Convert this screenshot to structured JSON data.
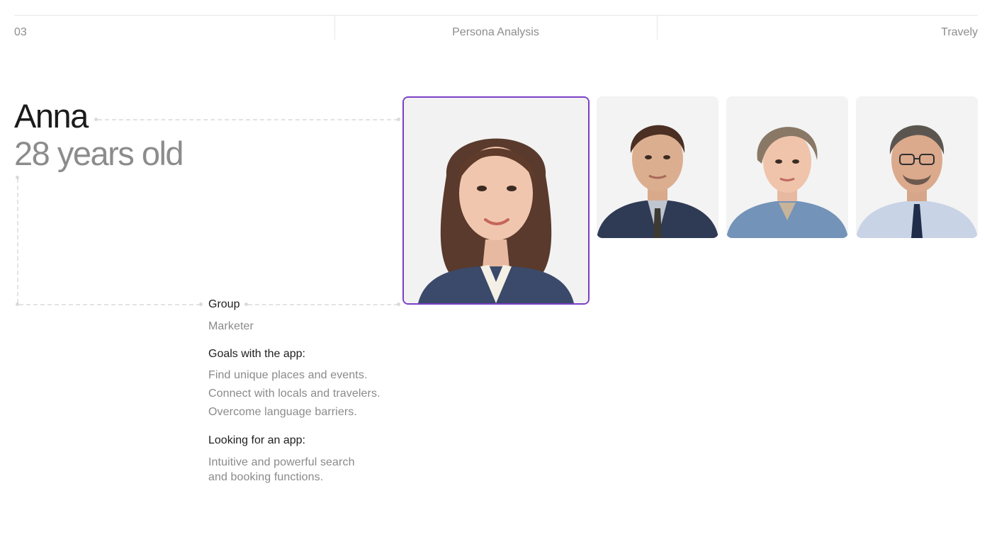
{
  "header": {
    "page_number": "03",
    "section_title": "Persona Analysis",
    "brand": "Travely"
  },
  "persona": {
    "name": "Anna",
    "age": "28 years old",
    "group_label": "Group",
    "group_value": "Marketer",
    "goals_label": "Goals with the app:",
    "goals": [
      "Find unique places and events.",
      "Connect with locals and travelers.",
      "Overcome language barriers."
    ],
    "looking_label": "Looking for an app:",
    "looking_lines": [
      "Intuitive and powerful search",
      "and booking functions."
    ]
  },
  "photos": [
    {
      "icon": "persona-avatar-woman-brown-hair",
      "selected": true
    },
    {
      "icon": "persona-avatar-man-suit",
      "selected": false
    },
    {
      "icon": "persona-avatar-woman-short-hair",
      "selected": false
    },
    {
      "icon": "persona-avatar-man-glasses",
      "selected": false
    }
  ],
  "colors": {
    "accent_selected": "#7c3fc6",
    "muted_text": "#8a8a8a",
    "divider": "#e6e6e6"
  }
}
